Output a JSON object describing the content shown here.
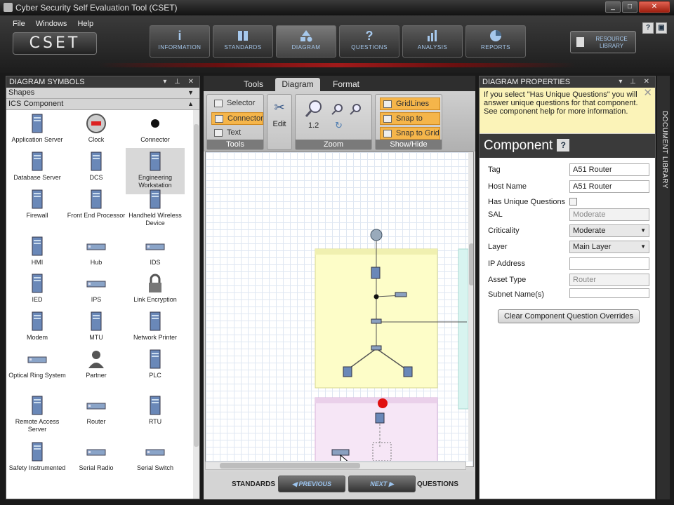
{
  "window": {
    "title": "Cyber Security Self Evaluation Tool (CSET)",
    "minimize": "_",
    "maximize": "□",
    "close": "✕"
  },
  "menu": [
    "File",
    "Windows",
    "Help"
  ],
  "logo": "CSET",
  "nav": [
    "INFORMATION",
    "STANDARDS",
    "DIAGRAM",
    "QUESTIONS",
    "ANALYSIS",
    "REPORTS"
  ],
  "nav_icons": {
    "information": "i",
    "questions": "?"
  },
  "resource_library": "RESOURCE LIBRARY",
  "help_button": "?",
  "left_panel": {
    "title": "DIAGRAM SYMBOLS",
    "sections": [
      "Shapes",
      "ICS Component"
    ],
    "symbols": [
      "Application Server",
      "Clock",
      "Connector",
      "Database Server",
      "DCS",
      "Engineering Workstation",
      "Firewall",
      "Front End Processor",
      "Handheld Wireless Device",
      "HMI",
      "Hub",
      "IDS",
      "IED",
      "IPS",
      "Link Encryption",
      "Modem",
      "MTU",
      "Network Printer",
      "Optical Ring System",
      "Partner",
      "PLC",
      "Remote Access Server",
      "Router",
      "RTU",
      "Safety Instrumented",
      "Serial Radio",
      "Serial Switch"
    ]
  },
  "ribbon": {
    "tabs": [
      "Tools",
      "Diagram",
      "Format"
    ],
    "tools": [
      "Selector",
      "Connector",
      "Text"
    ],
    "edit": "Edit",
    "zoom_value": "1.2",
    "showhide": [
      "GridLines",
      "Snap to Items",
      "Snap to Grid"
    ],
    "groups": [
      "Tools",
      "Zoom",
      "Show/Hide"
    ]
  },
  "bottom_nav": {
    "left": "STANDARDS",
    "prev": "PREVIOUS",
    "next": "NEXT",
    "right": "QUESTIONS"
  },
  "right_panel": {
    "title": "DIAGRAM PROPERTIES",
    "info": "If you select \"Has Unique Questions\" you will answer unique questions for that component. See component help for more information.",
    "component_title": "Component",
    "props": {
      "tag_label": "Tag",
      "tag_value": "A51 Router",
      "host_label": "Host Name",
      "host_value": "A51 Router",
      "unique_label": "Has Unique Questions",
      "sal_label": "SAL",
      "sal_value": "Moderate",
      "crit_label": "Criticality",
      "crit_value": "Moderate",
      "layer_label": "Layer",
      "layer_value": "Main Layer",
      "ip_label": "IP Address",
      "ip_value": "",
      "asset_label": "Asset Type",
      "asset_value": "Router",
      "subnet_label": "Subnet Name(s)",
      "subnet_value": ""
    },
    "clear_button": "Clear Component Question Overrides"
  },
  "document_library": "DOCUMENT LIBRARY",
  "colors": {
    "accent_orange": "#f5b54a",
    "zone_yellow": "#fdfdc8",
    "zone_pink": "#f6e6f6",
    "header_dark": "#3a3a3a"
  }
}
